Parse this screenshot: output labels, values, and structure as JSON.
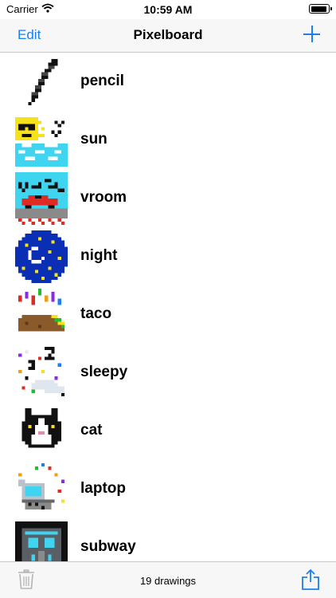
{
  "status_bar": {
    "carrier": "Carrier",
    "time": "10:59 AM"
  },
  "nav": {
    "edit_label": "Edit",
    "title": "Pixelboard",
    "add_icon": "plus-icon"
  },
  "drawings": [
    {
      "name": "pencil"
    },
    {
      "name": "sun"
    },
    {
      "name": "vroom"
    },
    {
      "name": "night"
    },
    {
      "name": "taco"
    },
    {
      "name": "sleepy"
    },
    {
      "name": "cat"
    },
    {
      "name": "laptop"
    },
    {
      "name": "subway"
    }
  ],
  "toolbar": {
    "count_label": "19 drawings",
    "trash_icon": "trash-icon",
    "share_icon": "share-icon"
  },
  "colors": {
    "accent": "#1a7ff0",
    "bar_background": "#f7f7f7"
  }
}
